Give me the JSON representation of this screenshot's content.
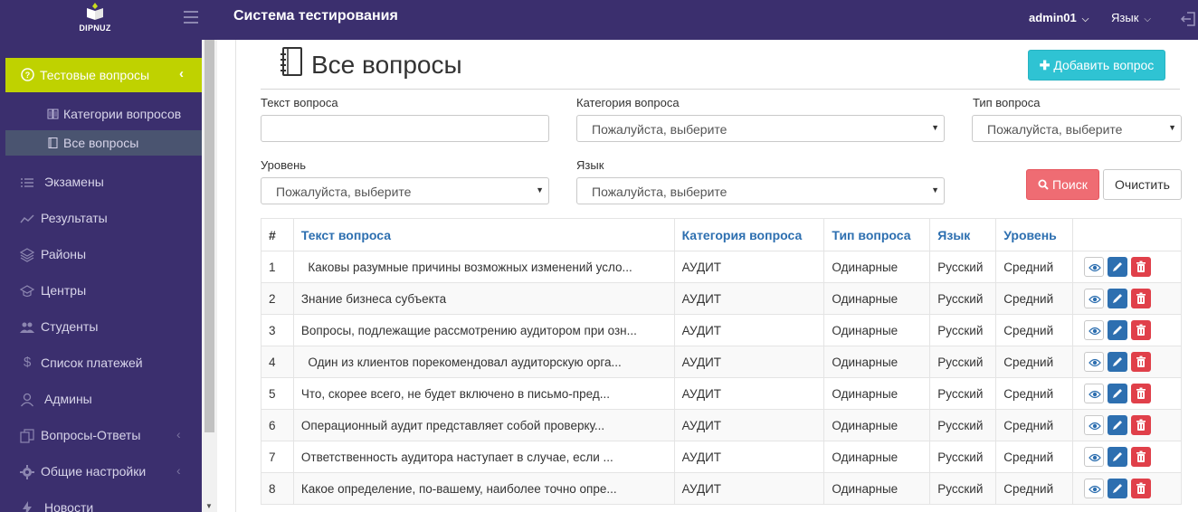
{
  "brand": {
    "logo_text": "DIPNUZ",
    "app_title": "Система тестирования"
  },
  "header": {
    "user": "admin01",
    "language": "Язык"
  },
  "sidebar": {
    "active": {
      "label": "Тестовые вопросы"
    },
    "sub_items": [
      {
        "label": "Категории вопросов"
      },
      {
        "label": "Все вопросы"
      }
    ],
    "items": [
      {
        "label": "Экзамены",
        "icon": "list-icon"
      },
      {
        "label": "Результаты",
        "icon": "chart-line-icon"
      },
      {
        "label": "Районы",
        "icon": "layers-icon"
      },
      {
        "label": "Центры",
        "icon": "graduation-cap-icon"
      },
      {
        "label": "Студенты",
        "icon": "users-icon"
      },
      {
        "label": "Список платежей",
        "icon": "dollar-icon"
      },
      {
        "label": "Админы",
        "icon": "user-icon"
      },
      {
        "label": "Вопросы-Ответы",
        "icon": "copy-icon"
      },
      {
        "label": "Общие настройки",
        "icon": "settings-icon"
      },
      {
        "label": "Новости",
        "icon": "bolt-icon"
      }
    ]
  },
  "page": {
    "title": "Все вопросы",
    "add_button": "Добавить вопрос"
  },
  "filters": {
    "question_text_label": "Текст вопроса",
    "question_text_value": "",
    "category_label": "Категория вопроса",
    "category_value": "Пожалуйста, выберите",
    "type_label": "Тип вопроса",
    "type_value": "Пожалуйста, выберите",
    "level_label": "Уровень",
    "level_value": "Пожалуйста, выберите",
    "lang_label": "Язык",
    "lang_value": "Пожалуйста, выберите",
    "search_button": "Поиск",
    "clear_button": "Очистить"
  },
  "table": {
    "columns": [
      "#",
      "Текст вопроса",
      "Категория вопроса",
      "Тип вопроса",
      "Язык",
      "Уровень"
    ],
    "rows": [
      {
        "n": "1",
        "text": "  Каковы разумные причины возможных изменений усло...",
        "category": "АУДИТ",
        "type": "Одинарные",
        "lang": "Русский",
        "level": "Средний"
      },
      {
        "n": "2",
        "text": "Знание бизнеса субъекта",
        "category": "АУДИТ",
        "type": "Одинарные",
        "lang": "Русский",
        "level": "Средний"
      },
      {
        "n": "3",
        "text": "Вопросы, подлежащие рассмотрению аудитором при озн...",
        "category": "АУДИТ",
        "type": "Одинарные",
        "lang": "Русский",
        "level": "Средний"
      },
      {
        "n": "4",
        "text": "  Один из клиентов порекомендовал аудиторскую орга...",
        "category": "АУДИТ",
        "type": "Одинарные",
        "lang": "Русский",
        "level": "Средний"
      },
      {
        "n": "5",
        "text": "Что, скорее всего, не будет включено в письмо-пред...",
        "category": "АУДИТ",
        "type": "Одинарные",
        "lang": "Русский",
        "level": "Средний"
      },
      {
        "n": "6",
        "text": "Операционный аудит представляет собой проверку...",
        "category": "АУДИТ",
        "type": "Одинарные",
        "lang": "Русский",
        "level": "Средний"
      },
      {
        "n": "7",
        "text": "Ответственность аудитора наступает в случае, если ...",
        "category": "АУДИТ",
        "type": "Одинарные",
        "lang": "Русский",
        "level": "Средний"
      },
      {
        "n": "8",
        "text": "Какое определение, по-вашему, наиболее точно опре...",
        "category": "АУДИТ",
        "type": "Одинарные",
        "lang": "Русский",
        "level": "Средний"
      }
    ]
  },
  "colors": {
    "nav_bg": "#3b2f6e",
    "active_item": "#bfd200",
    "accent_add": "#2fc3d3",
    "accent_search": "#ef6c73",
    "link": "#2d6fb0"
  }
}
